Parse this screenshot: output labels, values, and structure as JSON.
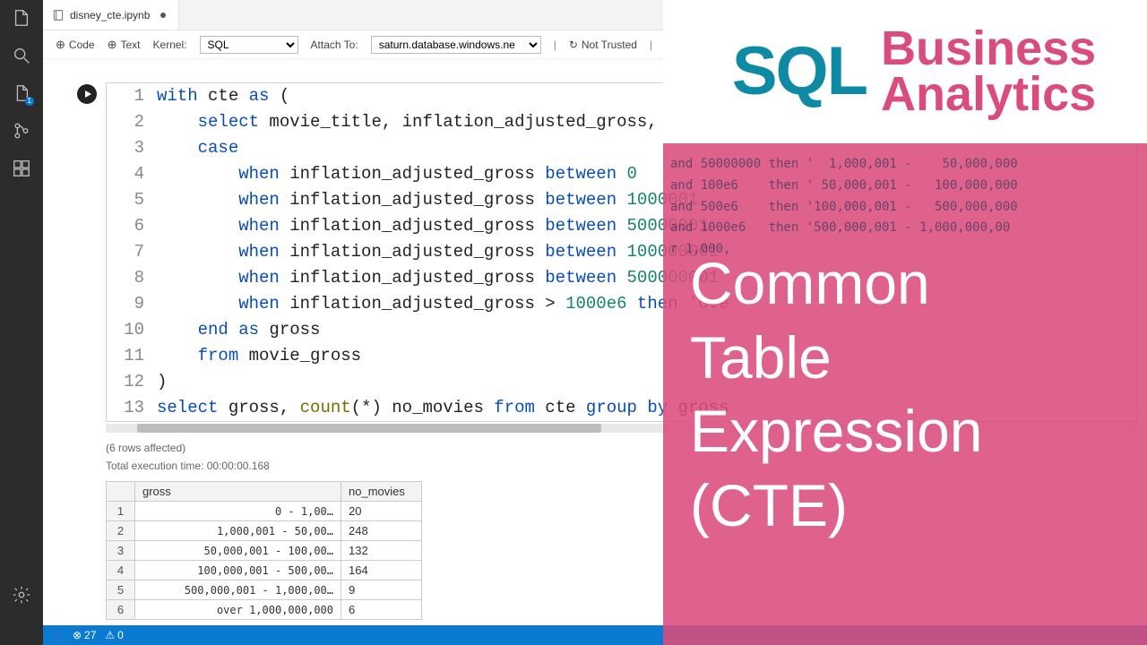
{
  "tab": {
    "filename": "disney_cte.ipynb"
  },
  "toolbar": {
    "code": "Code",
    "text": "Text",
    "kernel_label": "Kernel:",
    "kernel_value": "SQL",
    "attach_label": "Attach To:",
    "attach_value": "saturn.database.windows.ne",
    "trusted": "Not Trusted",
    "run": "Run"
  },
  "code_lines": [
    {
      "n": "1",
      "h": "<span class='kw'>with</span> cte <span class='kw'>as</span> ("
    },
    {
      "n": "2",
      "h": "    <span class='kw'>select</span> movie_title, inflation_adjusted_gross,"
    },
    {
      "n": "3",
      "h": "    <span class='kw'>case</span>"
    },
    {
      "n": "4",
      "h": "        <span class='kw'>when</span> inflation_adjusted_gross <span class='kw'>between</span> <span class='num'>0</span>"
    },
    {
      "n": "5",
      "h": "        <span class='kw'>when</span> inflation_adjusted_gross <span class='kw'>between</span> <span class='num'>1000001</span>"
    },
    {
      "n": "6",
      "h": "        <span class='kw'>when</span> inflation_adjusted_gross <span class='kw'>between</span> <span class='num'>50000001</span>"
    },
    {
      "n": "7",
      "h": "        <span class='kw'>when</span> inflation_adjusted_gross <span class='kw'>between</span> <span class='num'>100000001</span>"
    },
    {
      "n": "8",
      "h": "        <span class='kw'>when</span> inflation_adjusted_gross <span class='kw'>between</span> <span class='num'>500000001</span>"
    },
    {
      "n": "9",
      "h": "        <span class='kw'>when</span> inflation_adjusted_gross &gt; <span class='num'>1000e6</span> <span class='kw'>then</span> <span class='str'>'ove</span>"
    },
    {
      "n": "10",
      "h": "    <span class='kw'>end as</span> gross"
    },
    {
      "n": "11",
      "h": "    <span class='kw'>from</span> movie_gross"
    },
    {
      "n": "12",
      "h": ")"
    },
    {
      "n": "13",
      "h": "<span class='kw'>select</span> gross, <span class='fn'>count</span>(*) no_movies <span class='kw'>from</span> cte <span class='kw'>group by</span> gross"
    }
  ],
  "output": {
    "rows_affected": "(6 rows affected)",
    "exec_time": "Total execution time: 00:00:00.168",
    "headers": {
      "c1": "gross",
      "c2": "no_movies"
    },
    "rows": [
      {
        "i": "1",
        "g": "          0 -     1,00…",
        "n": "20"
      },
      {
        "i": "2",
        "g": "  1,000,001 -    50,00…",
        "n": "248"
      },
      {
        "i": "3",
        "g": " 50,000,001 -   100,00…",
        "n": "132"
      },
      {
        "i": "4",
        "g": "100,000,001 -   500,00…",
        "n": "164"
      },
      {
        "i": "5",
        "g": "500,000,001 - 1,000,00…",
        "n": "9"
      },
      {
        "i": "6",
        "g": "over 1,000,000,000",
        "n": "6"
      }
    ]
  },
  "status": {
    "user": "",
    "errors": "27",
    "warnings": "0"
  },
  "overlay": {
    "sql": "SQL",
    "ba1": "Business",
    "ba2": "Analytics",
    "l1": "Common",
    "l2": "Table",
    "l3": "Expression",
    "l4": "(CTE)",
    "ghost": "and 50000000 then '  1,000,001 -    50,000,000\nand 100e6    then ' 50,000,001 -   100,000,000\nand 500e6    then '100,000,001 -   500,000,000\nand 1000e6   then '500,000,001 - 1,000,000,00\nr 1,000,"
  }
}
